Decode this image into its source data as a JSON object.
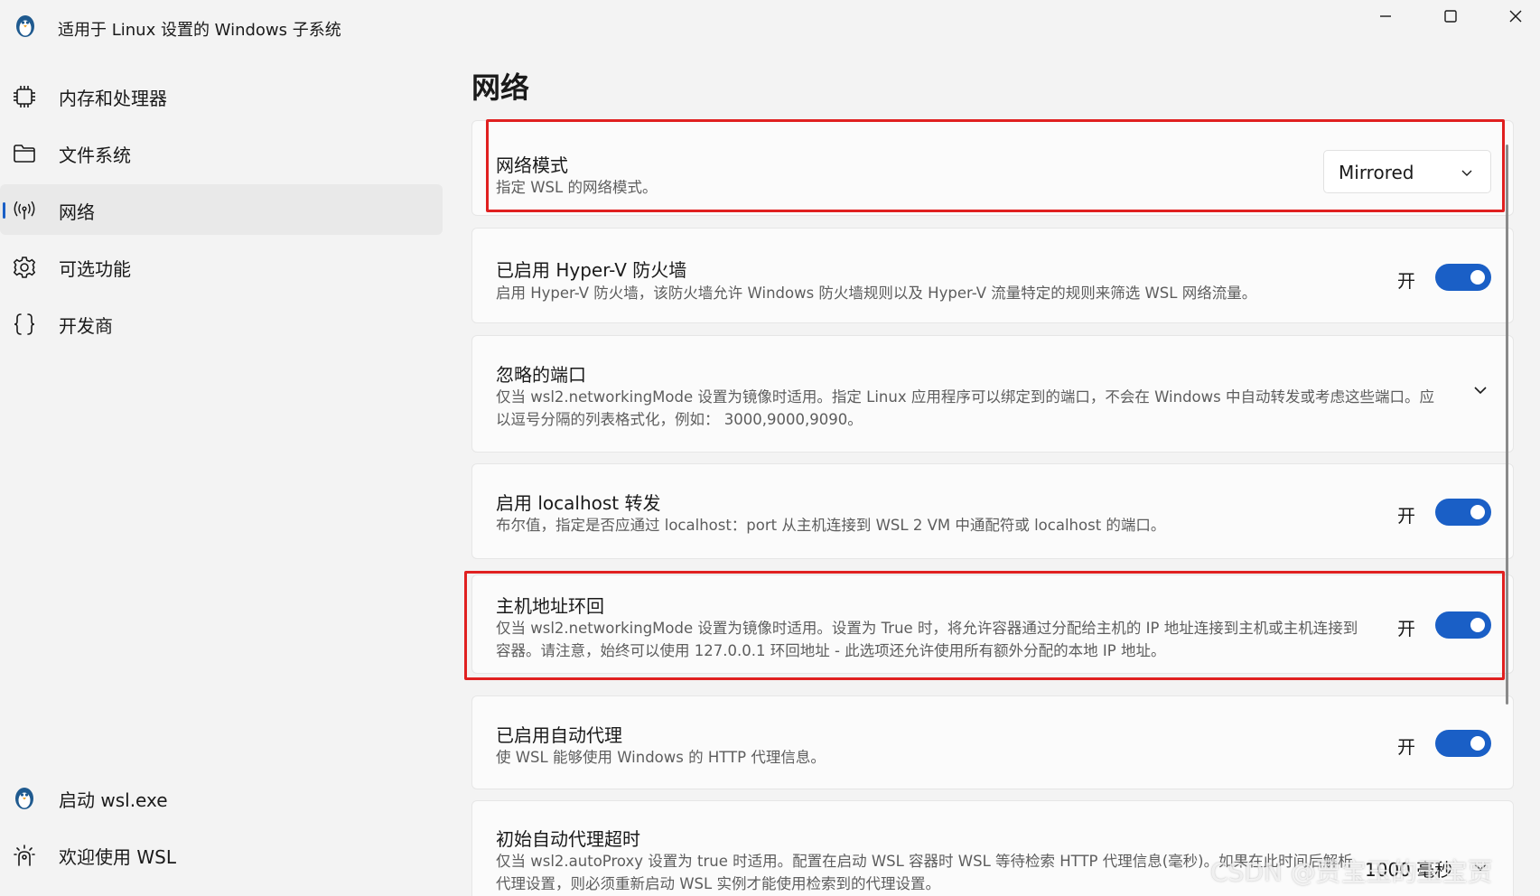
{
  "window": {
    "title": "适用于 Linux 设置的 Windows 子系统"
  },
  "sidebar": {
    "items": [
      {
        "label": "内存和处理器",
        "icon": "cpu-icon"
      },
      {
        "label": "文件系统",
        "icon": "folder-icon"
      },
      {
        "label": "网络",
        "icon": "network-icon",
        "selected": true
      },
      {
        "label": "可选功能",
        "icon": "gear-icon"
      },
      {
        "label": "开发商",
        "icon": "braces-icon"
      }
    ],
    "bottom_items": [
      {
        "label": "启动 wsl.exe",
        "icon": "penguin-icon"
      },
      {
        "label": "欢迎使用 WSL",
        "icon": "welcome-icon"
      }
    ]
  },
  "main": {
    "page_title": "网络",
    "settings": [
      {
        "title": "网络模式",
        "desc": "指定 WSL 的网络模式。",
        "control": "dropdown",
        "value": "Mirrored",
        "highlighted": true
      },
      {
        "title": "已启用 Hyper-V 防火墙",
        "desc": "启用 Hyper-V 防火墙，该防火墙允许 Windows 防火墙规则以及 Hyper-V 流量特定的规则来筛选 WSL 网络流量。",
        "control": "toggle",
        "state_label": "开",
        "on": true
      },
      {
        "title": "忽略的端口",
        "desc": "仅当 wsl2.networkingMode 设置为镜像时适用。指定 Linux 应用程序可以绑定到的端口，不会在 Windows 中自动转发或考虑这些端口。应以逗号分隔的列表格式化，例如： 3000,9000,9090。",
        "control": "expander"
      },
      {
        "title": "启用 localhost 转发",
        "desc": "布尔值，指定是否应通过 localhost：port 从主机连接到 WSL 2 VM 中通配符或 localhost 的端口。",
        "control": "toggle",
        "state_label": "开",
        "on": true
      },
      {
        "title": "主机地址环回",
        "desc": "仅当 wsl2.networkingMode 设置为镜像时适用。设置为 True 时，将允许容器通过分配给主机的 IP 地址连接到主机或主机连接到容器。请注意，始终可以使用 127.0.0.1 环回地址 - 此选项还允许使用所有额外分配的本地 IP 地址。",
        "control": "toggle",
        "state_label": "开",
        "on": true,
        "highlighted": true
      },
      {
        "title": "已启用自动代理",
        "desc": "使 WSL 能够使用 Windows 的 HTTP 代理信息。",
        "control": "toggle",
        "state_label": "开",
        "on": true
      },
      {
        "title": "初始自动代理超时",
        "desc": "仅当 wsl2.autoProxy 设置为 true 时适用。配置在启动 WSL 容器时 WSL 等待检索 HTTP 代理信息(毫秒)。如果在此时间后解析代理设置，则必须重新启动 WSL 实例才能使用检索到的代理设置。",
        "control": "expander",
        "value": "1000 毫秒"
      }
    ]
  },
  "watermark": "CSDN @贾宝玉的玉宝贾",
  "colors": {
    "accent": "#1a5fc6",
    "highlight": "#e02020"
  }
}
